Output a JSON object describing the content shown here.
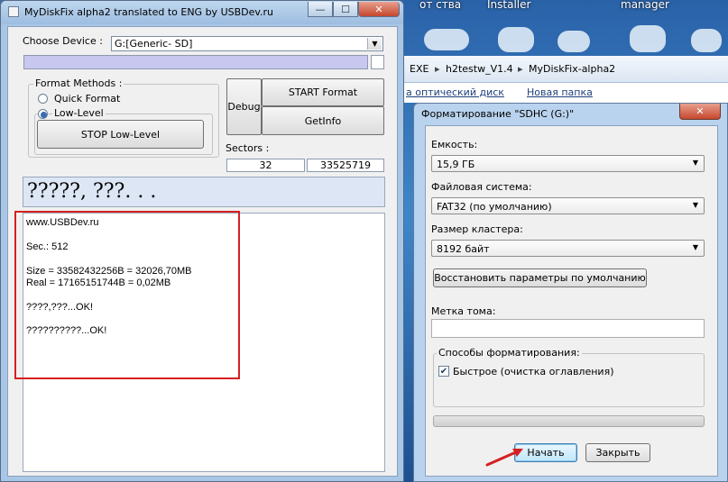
{
  "desktop": {
    "labels": [
      "от ства",
      "Installer",
      "manager"
    ]
  },
  "explorer": {
    "breadcrumb": [
      "EXE",
      "h2testw_V1.4",
      "MyDiskFix-alpha2"
    ],
    "links": [
      "а оптический диск",
      "Новая папка"
    ]
  },
  "mydiskfix": {
    "title": "MyDiskFix alpha2  translated to ENG by USBDev.ru",
    "choose_device_label": "Choose Device :",
    "device_value": "G:[Generic- SD]",
    "format_methods_label": "Format Methods :",
    "quick_format_label": "Quick Format",
    "low_level_label": "Low-Level",
    "selected_method": "Low-Level",
    "stop_button": "STOP Low-Level",
    "debug_button": "Debug",
    "start_button": "START Format",
    "getinfo_button": "GetInfo",
    "sectors_label": "Sectors :",
    "sectors_start": "32",
    "sectors_end": "33525719",
    "status_text": "?????, ???. . .",
    "log": {
      "line1": "www.USBDev.ru",
      "line2": "Sec.: 512",
      "line3": "Size = 33582432256B  = 32026,70MB",
      "line4": "Real = 17165151744B  = 0,02MB",
      "line5": "????,???...OK!",
      "line6": "??????????...OK!"
    }
  },
  "format_dialog": {
    "title": "Форматирование \"SDHC (G:)\"",
    "capacity_label": "Емкость:",
    "capacity_value": "15,9 ГБ",
    "fs_label": "Файловая система:",
    "fs_value": "FAT32 (по умолчанию)",
    "cluster_label": "Размер кластера:",
    "cluster_value": "8192 байт",
    "restore_button": "Восстановить параметры по умолчанию",
    "volume_label": "Метка тома:",
    "volume_value": "",
    "methods_label": "Способы форматирования:",
    "quick_label": "Быстрое (очистка оглавления)",
    "quick_checked": true,
    "start_button": "Начать",
    "close_button": "Закрыть"
  },
  "colors": {
    "annotation_red": "#d62020",
    "progress_fill": "#c7c7f0"
  }
}
